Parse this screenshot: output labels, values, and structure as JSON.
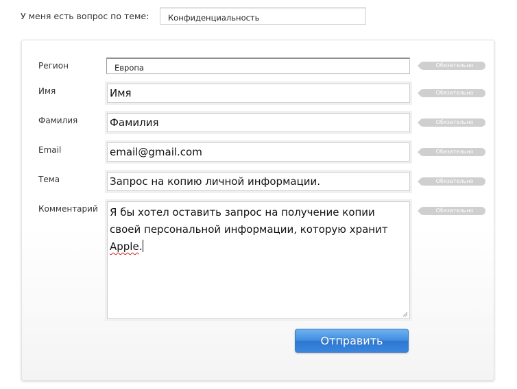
{
  "topic": {
    "label": "У меня есть вопрос по теме:",
    "selected": "Конфиденциальность"
  },
  "form": {
    "required_text": "Обязательно",
    "fields": {
      "region": {
        "label": "Регион",
        "value": "Европа"
      },
      "first_name": {
        "label": "Имя",
        "value": "Имя"
      },
      "last_name": {
        "label": "Фамилия",
        "value": "Фамилия"
      },
      "email": {
        "label": "Email",
        "value": "email@gmail.com"
      },
      "subject": {
        "label": "Тема",
        "value": "Запрос на копию личной информации."
      },
      "comment": {
        "label": "Комментарий",
        "value_before": "Я бы хотел оставить запрос на получение копии своей персональной информации, которую хранит ",
        "value_misspelled": "Apple",
        "value_after": "."
      }
    },
    "submit_label": "Отправить"
  },
  "colors": {
    "button_blue": "#3f8ce0",
    "badge_gray": "#cfcfcf",
    "spellcheck_red": "#d21f1f"
  }
}
